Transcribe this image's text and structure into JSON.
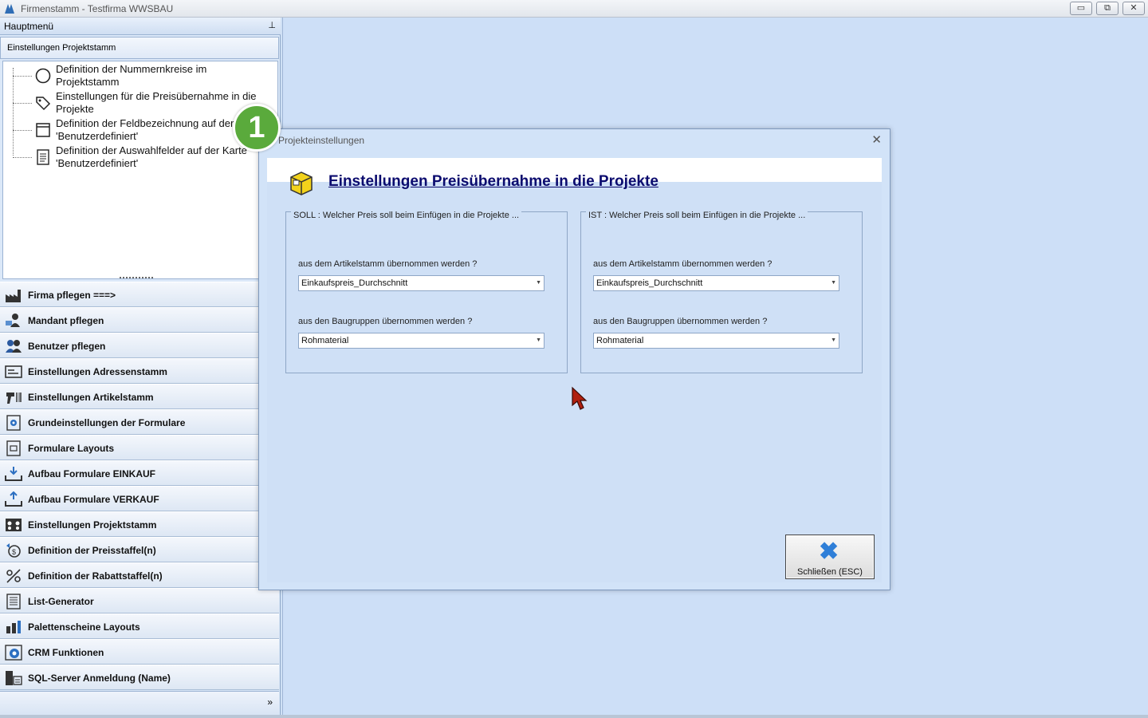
{
  "window": {
    "title": "Firmenstamm - Testfirma WWSBAU",
    "minimize": "▭",
    "restore": "⧉",
    "close": "✕"
  },
  "sidebar": {
    "header": "Hauptmenü",
    "pin": "⊥",
    "section": "Einstellungen Projektstamm",
    "tree": [
      {
        "label": "Definition der Nummernkreise im Projektstamm",
        "icon": "circle-icon"
      },
      {
        "label": "Einstellungen für die Preisübernahme in die Projekte",
        "icon": "price-tag-icon"
      },
      {
        "label": "Definition der Feldbezeichnung auf der Karte 'Benutzerdefiniert'",
        "icon": "form-icon"
      },
      {
        "label": "Definition der Auswahlfelder auf der Karte 'Benutzerdefiniert'",
        "icon": "list-document-icon"
      }
    ],
    "nav": [
      {
        "label": "Firma pflegen    ===>",
        "icon": "factory-icon"
      },
      {
        "label": "Mandant pflegen",
        "icon": "client-icon"
      },
      {
        "label": "Benutzer pflegen",
        "icon": "users-icon"
      },
      {
        "label": "Einstellungen Adressenstamm",
        "icon": "address-card-icon"
      },
      {
        "label": "Einstellungen Artikelstamm",
        "icon": "barcode-scanner-icon"
      },
      {
        "label": "Grundeinstellungen der Formulare",
        "icon": "form-settings-icon"
      },
      {
        "label": "Formulare Layouts",
        "icon": "layout-icon"
      },
      {
        "label": "Aufbau Formulare EINKAUF",
        "icon": "download-tray-icon"
      },
      {
        "label": "Aufbau Formulare VERKAUF",
        "icon": "upload-tray-icon"
      },
      {
        "label": "Einstellungen Projektstamm",
        "icon": "project-icon"
      },
      {
        "label": "Definition der Preisstaffel(n)",
        "icon": "price-scale-icon"
      },
      {
        "label": "Definition der Rabattstaffel(n)",
        "icon": "percent-icon"
      },
      {
        "label": "List-Generator",
        "icon": "list-icon"
      },
      {
        "label": "Palettenscheine Layouts",
        "icon": "pallet-icon"
      },
      {
        "label": "CRM Funktionen",
        "icon": "crm-icon"
      },
      {
        "label": "SQL-Server Anmeldung (Name)",
        "icon": "server-icon"
      }
    ],
    "more": "»"
  },
  "dialog": {
    "title": "Projekteinstellungen",
    "close": "✕",
    "headline": "Einstellungen Preisübernahme in die Projekte",
    "soll": {
      "legend": "SOLL : Welcher Preis soll beim Einfügen in die Projekte ...",
      "article_label": "aus dem Artikelstamm übernommen werden ?",
      "article_value": "Einkaufspreis_Durchschnitt",
      "group_label": "aus den Baugruppen übernommen werden ?",
      "group_value": "Rohmaterial"
    },
    "ist": {
      "legend": "IST : Welcher Preis soll beim Einfügen in die Projekte ...",
      "article_label": "aus dem Artikelstamm übernommen werden ?",
      "article_value": "Einkaufspreis_Durchschnitt",
      "group_label": "aus den Baugruppen übernommen werden ?",
      "group_value": "Rohmaterial"
    },
    "close_button": "Schließen (ESC)"
  },
  "badge": "1"
}
